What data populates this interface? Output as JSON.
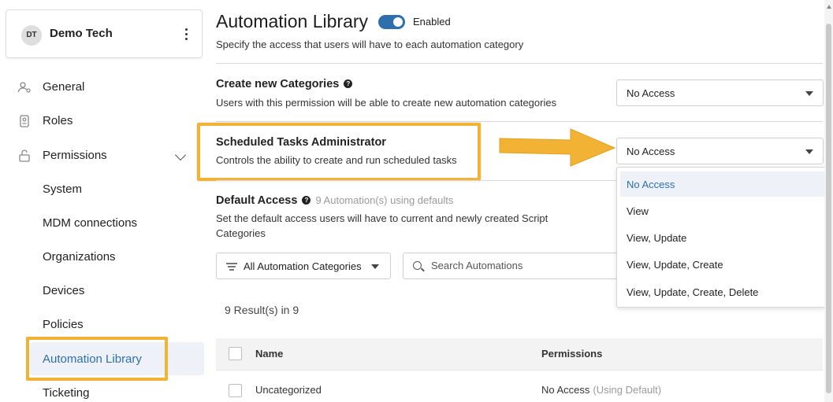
{
  "org": {
    "initials": "DT",
    "name": "Demo Tech"
  },
  "sidebar": {
    "items": [
      {
        "label": "General",
        "icon": "user-gear-icon"
      },
      {
        "label": "Roles",
        "icon": "badge-icon"
      },
      {
        "label": "Permissions",
        "icon": "unlock-icon"
      },
      {
        "label": "System"
      },
      {
        "label": "MDM connections"
      },
      {
        "label": "Organizations"
      },
      {
        "label": "Devices"
      },
      {
        "label": "Policies"
      },
      {
        "label": "Automation Library",
        "active": true
      },
      {
        "label": "Ticketing"
      }
    ]
  },
  "header": {
    "title": "Automation Library",
    "toggle_label": "Enabled",
    "toggle_on": true,
    "subtitle": "Specify the access that users will have to each automation category"
  },
  "sections": {
    "create_categories": {
      "title": "Create new Categories",
      "description": "Users with this permission will be able to create new automation categories",
      "value": "No Access"
    },
    "scheduled_tasks": {
      "title": "Scheduled Tasks Administrator",
      "description": "Controls the ability to create and run scheduled tasks",
      "value": "No Access"
    },
    "default_access": {
      "title": "Default Access",
      "note": "9 Automation(s) using defaults",
      "description_line1": "Set the default access users will have to current and newly created Script",
      "description_line2": "Categories"
    }
  },
  "dropdown": {
    "options": [
      "No Access",
      "View",
      "View, Update",
      "View, Update, Create",
      "View, Update, Create, Delete"
    ],
    "selected": "No Access"
  },
  "filters": {
    "category_filter": "All Automation Categories",
    "search_placeholder": "Search Automations"
  },
  "results_text": "9 Result(s) in 9",
  "table": {
    "columns": [
      "Name",
      "Permissions"
    ],
    "rows": [
      {
        "name": "Uncategorized",
        "permission": "No Access",
        "permission_note": "(Using Default)"
      }
    ]
  },
  "colors": {
    "accent": "#2f6fad",
    "highlight": "#f2b233"
  }
}
